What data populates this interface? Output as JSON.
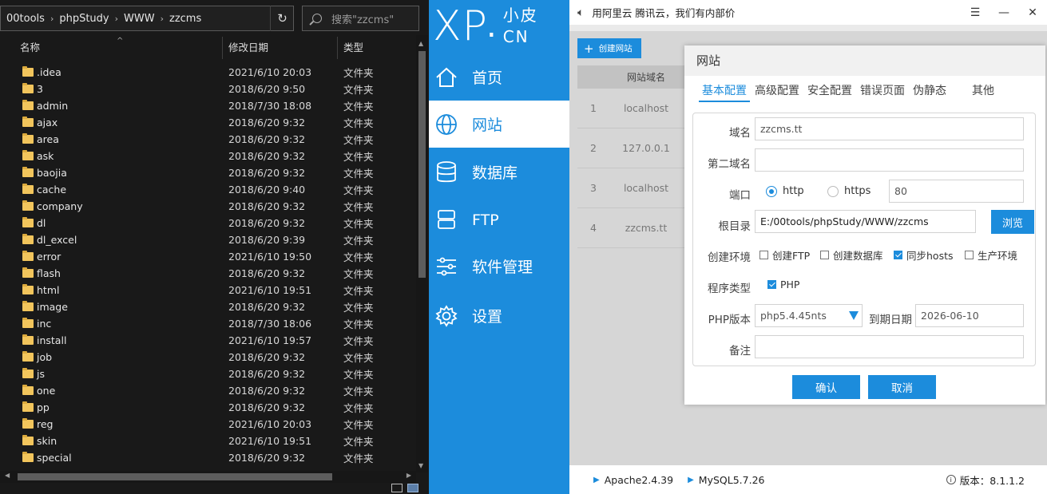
{
  "explorer": {
    "breadcrumbs": [
      "00tools",
      "phpStudy",
      "WWW",
      "zzcms"
    ],
    "search_placeholder": "搜索\"zzcms\"",
    "columns": {
      "name": "名称",
      "date": "修改日期",
      "type": "类型"
    },
    "rows": [
      {
        "name": ".idea",
        "date": "2021/6/10 20:03",
        "type": "文件夹"
      },
      {
        "name": "3",
        "date": "2018/6/20 9:50",
        "type": "文件夹"
      },
      {
        "name": "admin",
        "date": "2018/7/30 18:08",
        "type": "文件夹"
      },
      {
        "name": "ajax",
        "date": "2018/6/20 9:32",
        "type": "文件夹"
      },
      {
        "name": "area",
        "date": "2018/6/20 9:32",
        "type": "文件夹"
      },
      {
        "name": "ask",
        "date": "2018/6/20 9:32",
        "type": "文件夹"
      },
      {
        "name": "baojia",
        "date": "2018/6/20 9:32",
        "type": "文件夹"
      },
      {
        "name": "cache",
        "date": "2018/6/20 9:40",
        "type": "文件夹"
      },
      {
        "name": "company",
        "date": "2018/6/20 9:32",
        "type": "文件夹"
      },
      {
        "name": "dl",
        "date": "2018/6/20 9:32",
        "type": "文件夹"
      },
      {
        "name": "dl_excel",
        "date": "2018/6/20 9:39",
        "type": "文件夹"
      },
      {
        "name": "error",
        "date": "2021/6/10 19:50",
        "type": "文件夹"
      },
      {
        "name": "flash",
        "date": "2018/6/20 9:32",
        "type": "文件夹"
      },
      {
        "name": "html",
        "date": "2021/6/10 19:51",
        "type": "文件夹"
      },
      {
        "name": "image",
        "date": "2018/6/20 9:32",
        "type": "文件夹"
      },
      {
        "name": "inc",
        "date": "2018/7/30 18:06",
        "type": "文件夹"
      },
      {
        "name": "install",
        "date": "2021/6/10 19:57",
        "type": "文件夹"
      },
      {
        "name": "job",
        "date": "2018/6/20 9:32",
        "type": "文件夹"
      },
      {
        "name": "js",
        "date": "2018/6/20 9:32",
        "type": "文件夹"
      },
      {
        "name": "one",
        "date": "2018/6/20 9:32",
        "type": "文件夹"
      },
      {
        "name": "pp",
        "date": "2018/6/20 9:32",
        "type": "文件夹"
      },
      {
        "name": "reg",
        "date": "2021/6/10 20:03",
        "type": "文件夹"
      },
      {
        "name": "skin",
        "date": "2021/6/10 19:51",
        "type": "文件夹"
      },
      {
        "name": "special",
        "date": "2018/6/20 9:32",
        "type": "文件夹"
      }
    ]
  },
  "sidebar": {
    "logo": {
      "main": "XP",
      "sub_top": "小皮",
      "sub_bottom": "CN"
    },
    "items": [
      {
        "label": "首页",
        "icon": "home-icon"
      },
      {
        "label": "网站",
        "icon": "globe-icon"
      },
      {
        "label": "数据库",
        "icon": "database-icon"
      },
      {
        "label": "FTP",
        "icon": "server-icon"
      },
      {
        "label": "软件管理",
        "icon": "sliders-icon"
      },
      {
        "label": "设置",
        "icon": "gear-icon"
      }
    ],
    "active_index": 1
  },
  "main": {
    "banner": "用阿里云 腾讯云，我们有内部价",
    "create_site_label": "创建网站",
    "table_header": "网站域名",
    "sites": [
      {
        "num": "1",
        "domain": "localhost"
      },
      {
        "num": "2",
        "domain": "127.0.0.1"
      },
      {
        "num": "3",
        "domain": "localhost"
      },
      {
        "num": "4",
        "domain": "zzcms.tt"
      }
    ],
    "status": {
      "apache": "Apache2.4.39",
      "mysql": "MySQL5.7.26",
      "version": "版本：8.1.1.2"
    }
  },
  "dialog": {
    "title": "网站",
    "tabs": [
      "基本配置",
      "高级配置",
      "安全配置",
      "错误页面",
      "伪静态",
      "其他"
    ],
    "labels": {
      "domain": "域名",
      "second_domain": "第二域名",
      "port": "端口",
      "root": "根目录",
      "env": "创建环境",
      "program_type": "程序类型",
      "php_version": "PHP版本",
      "expire": "到期日期",
      "note": "备注"
    },
    "values": {
      "domain": "zzcms.tt",
      "second_domain": "",
      "port": "80",
      "root": "E:/00tools/phpStudy/WWW/zzcms",
      "php_version": "php5.4.45nts",
      "expire": "2026-06-10",
      "note": ""
    },
    "radios": {
      "http": "http",
      "https": "https",
      "selected": "http"
    },
    "env_options": [
      {
        "label": "创建FTP",
        "checked": false
      },
      {
        "label": "创建数据库",
        "checked": false
      },
      {
        "label": "同步hosts",
        "checked": true
      },
      {
        "label": "生产环境",
        "checked": false
      }
    ],
    "program_options": [
      {
        "label": "PHP",
        "checked": true
      }
    ],
    "browse_label": "浏览",
    "confirm_label": "确认",
    "cancel_label": "取消"
  },
  "colors": {
    "accent": "#1c8cdc",
    "explorer_bg": "#191919",
    "folder": "#f2c55c"
  }
}
